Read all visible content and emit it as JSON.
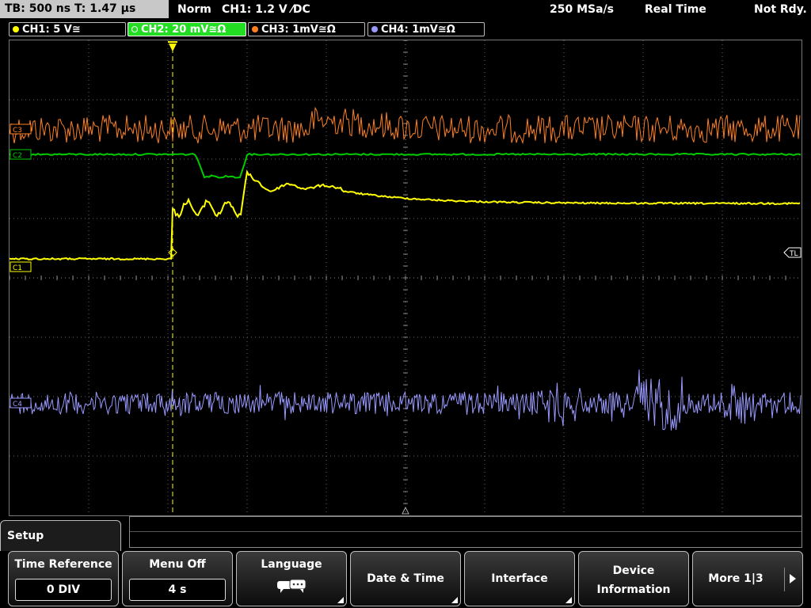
{
  "status": {
    "timebase": "TB: 500 ns   T: 1.47 µs",
    "mode": "Norm",
    "trigger": "CH1: 1.2 V ⁄DC",
    "sample_rate": "250 MSa/s",
    "acq_mode": "Real Time",
    "ready": "Not Rdy."
  },
  "channels": [
    {
      "label": "CH1: 5 V≅",
      "color": "#ffff00",
      "active": false
    },
    {
      "label": "CH2: 20 mV≅Ω",
      "color": "#00cc00",
      "active": true
    },
    {
      "label": "CH3: 1mV≅Ω",
      "color": "#ff8020",
      "active": false
    },
    {
      "label": "CH4: 1mV≅Ω",
      "color": "#9999ff",
      "active": false
    }
  ],
  "markers": {
    "trigger_level": "TL",
    "ch1": "C1",
    "ch2": "C2",
    "ch3": "C3",
    "ch4": "C4"
  },
  "menu": {
    "title": "Setup",
    "softkeys": [
      {
        "label": "Time Reference",
        "value": "0 DIV"
      },
      {
        "label": "Menu Off",
        "value": "4 s"
      },
      {
        "label": "Language"
      },
      {
        "label": "Date & Time"
      },
      {
        "label": "Interface"
      },
      {
        "label": "Device",
        "label2": "Information"
      },
      {
        "label": "More 1|3"
      }
    ]
  },
  "colors": {
    "ch1": "#ffff00",
    "ch2": "#00cc00",
    "ch3": "#ff8020",
    "ch4": "#9999ff",
    "grid": "#666666"
  }
}
